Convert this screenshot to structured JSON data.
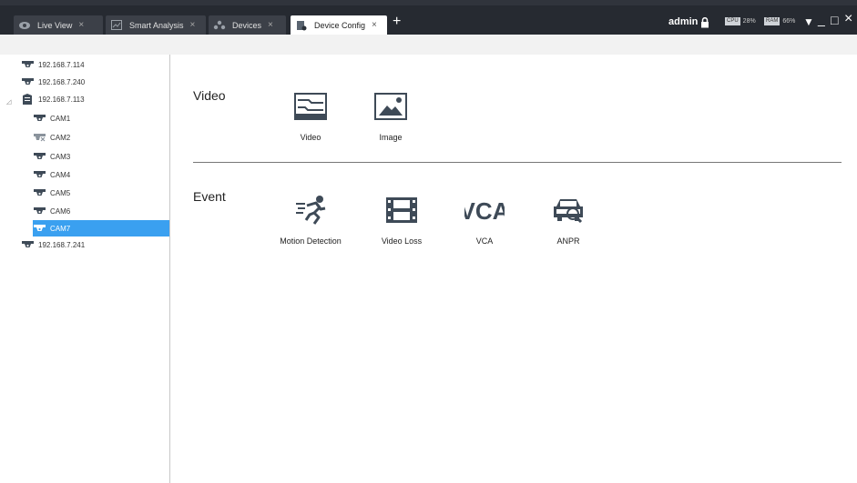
{
  "tabs": [
    {
      "label": "Live View",
      "icon": "eye-icon",
      "active": false
    },
    {
      "label": "Smart Analysis",
      "icon": "image-analysis-icon",
      "active": false
    },
    {
      "label": "Devices",
      "icon": "devices-icon",
      "active": false
    },
    {
      "label": "Device Config",
      "icon": "device-config-icon",
      "active": true
    }
  ],
  "tab_close": "×",
  "tab_add": "+",
  "user": "admin",
  "cpu": {
    "badge": "CPU",
    "value": "28%"
  },
  "ram": {
    "badge": "RAM",
    "value": "66%"
  },
  "window_buttons": {
    "menu": "▼",
    "minimize": "_",
    "maximize": "□",
    "close": "×"
  },
  "tree": [
    {
      "label": "192.168.7.114",
      "icon": "camera-icon"
    },
    {
      "label": "192.168.7.240",
      "icon": "camera-icon"
    },
    {
      "label": "192.168.7.113",
      "icon": "nvr-icon"
    },
    {
      "label": "CAM1",
      "icon": "camera-icon"
    },
    {
      "label": "CAM2",
      "icon": "camera-offline-icon"
    },
    {
      "label": "CAM3",
      "icon": "camera-icon"
    },
    {
      "label": "CAM4",
      "icon": "camera-icon"
    },
    {
      "label": "CAM5",
      "icon": "camera-icon"
    },
    {
      "label": "CAM6",
      "icon": "camera-icon"
    },
    {
      "label": "CAM7",
      "icon": "camera-icon",
      "selected": true
    },
    {
      "label": "192.168.7.241",
      "icon": "camera-icon"
    }
  ],
  "sections": {
    "video": {
      "title": "Video",
      "items": [
        {
          "label": "Video",
          "icon": "video-settings-icon"
        },
        {
          "label": "Image",
          "icon": "image-icon"
        }
      ]
    },
    "event": {
      "title": "Event",
      "items": [
        {
          "label": "Motion Detection",
          "icon": "motion-detection-icon"
        },
        {
          "label": "Video Loss",
          "icon": "video-loss-icon"
        },
        {
          "label": "VCA",
          "icon": "vca-icon",
          "icon_text": "VCA"
        },
        {
          "label": "ANPR",
          "icon": "anpr-icon"
        }
      ]
    }
  },
  "colors": {
    "titlebar": "#262a31",
    "selection": "#3aa0f0",
    "icon": "#3e4a57"
  }
}
